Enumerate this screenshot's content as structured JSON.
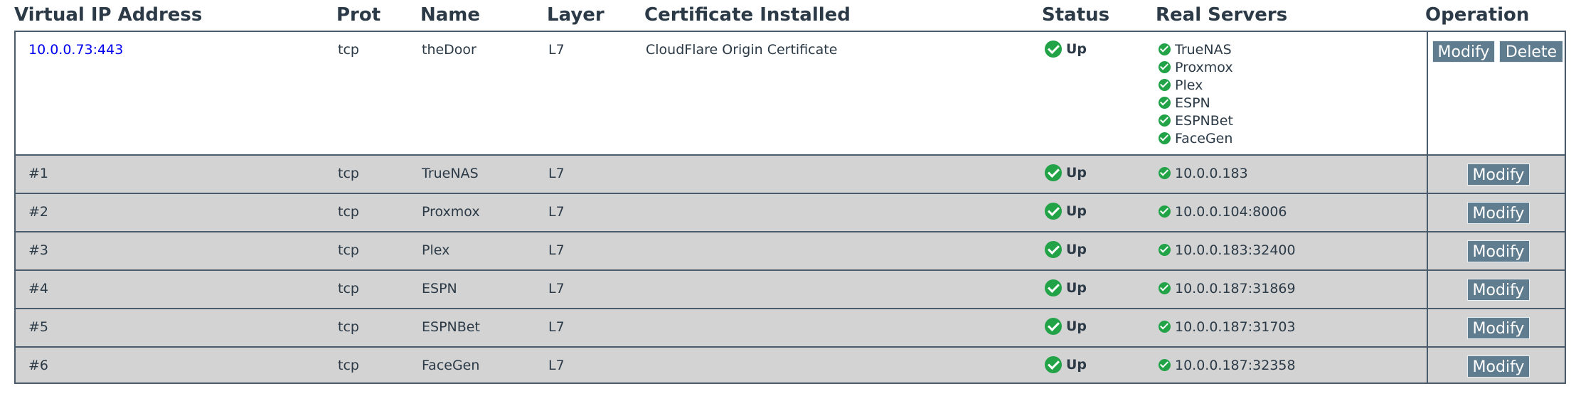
{
  "headers": {
    "vip": "Virtual IP Address",
    "prot": "Prot",
    "name": "Name",
    "layer": "Layer",
    "cert": "Certificate Installed",
    "status": "Status",
    "real": "Real Servers",
    "operation": "Operation"
  },
  "virtual_service": {
    "vip": "10.0.0.73:443",
    "prot": "tcp",
    "name": "theDoor",
    "layer": "L7",
    "cert": "CloudFlare Origin Certificate",
    "status": "Up",
    "real_servers": [
      "TrueNAS",
      "Proxmox",
      "Plex",
      "ESPN",
      "ESPNBet",
      "FaceGen"
    ],
    "modify_label": "Modify",
    "delete_label": "Delete"
  },
  "sub_services": [
    {
      "id": "#1",
      "prot": "tcp",
      "name": "TrueNAS",
      "layer": "L7",
      "status": "Up",
      "real": "10.0.0.183",
      "modify_label": "Modify"
    },
    {
      "id": "#2",
      "prot": "tcp",
      "name": "Proxmox",
      "layer": "L7",
      "status": "Up",
      "real": "10.0.0.104:8006",
      "modify_label": "Modify"
    },
    {
      "id": "#3",
      "prot": "tcp",
      "name": "Plex",
      "layer": "L7",
      "status": "Up",
      "real": "10.0.0.183:32400",
      "modify_label": "Modify"
    },
    {
      "id": "#4",
      "prot": "tcp",
      "name": "ESPN",
      "layer": "L7",
      "status": "Up",
      "real": "10.0.0.187:31869",
      "modify_label": "Modify"
    },
    {
      "id": "#5",
      "prot": "tcp",
      "name": "ESPNBet",
      "layer": "L7",
      "status": "Up",
      "real": "10.0.0.187:31703",
      "modify_label": "Modify"
    },
    {
      "id": "#6",
      "prot": "tcp",
      "name": "FaceGen",
      "layer": "L7",
      "status": "Up",
      "real": "10.0.0.187:32358",
      "modify_label": "Modify"
    }
  ],
  "colors": {
    "accent_button": "#607d8f",
    "status_ok": "#22a347",
    "row_sub_bg": "#d3d3d3",
    "link": "#0000ee"
  }
}
